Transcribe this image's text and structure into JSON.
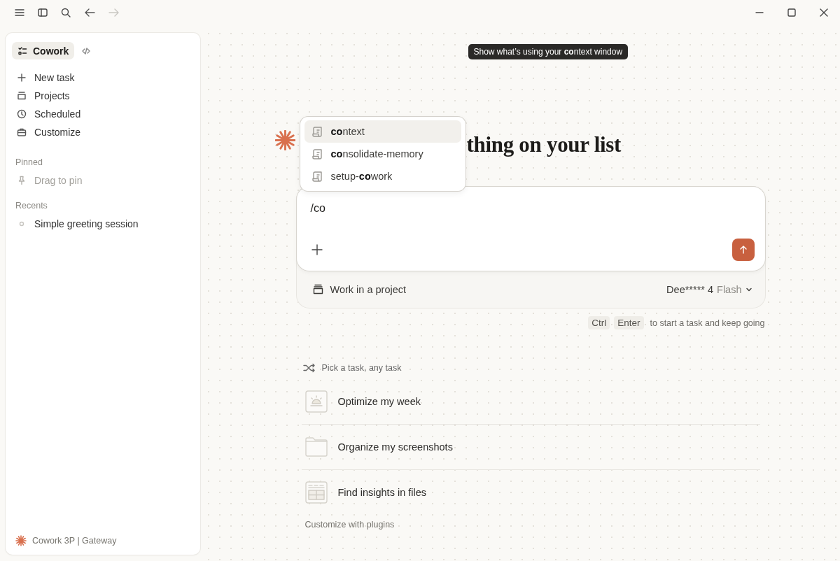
{
  "titlebar": {
    "back": {
      "disabled": false
    },
    "forward": {
      "disabled": true
    }
  },
  "sidebar": {
    "mode_tabs": [
      {
        "label": "Cowork",
        "selected": true
      }
    ],
    "nav": [
      {
        "label": "New task"
      },
      {
        "label": "Projects"
      },
      {
        "label": "Scheduled"
      },
      {
        "label": "Customize"
      }
    ],
    "pinned": {
      "heading": "Pinned",
      "hint": "Drag to pin"
    },
    "recents": {
      "heading": "Recents",
      "items": [
        {
          "label": "Simple greeting session"
        }
      ]
    },
    "footer": "Cowork 3P | Gateway"
  },
  "heading": "thing on your list",
  "command_menu": {
    "items": [
      {
        "label": "**co**ntext",
        "selected": true
      },
      {
        "label": "**co**nsolidate-memory",
        "selected": false
      },
      {
        "label": "setup-**co**work",
        "selected": false
      }
    ]
  },
  "tooltip": "Show what’s using your **co**ntext window",
  "composer": {
    "value": "/co",
    "project_button": "Work in a project",
    "model_name": "Dee***** 4",
    "model_variant": "Flash"
  },
  "shortcut": {
    "keys": [
      "Ctrl",
      "Enter"
    ],
    "text": "to start a task and keep going"
  },
  "suggestions": {
    "heading": "Pick a task, any task",
    "items": [
      {
        "label": "Optimize my week"
      },
      {
        "label": "Organize my screenshots"
      },
      {
        "label": "Find insights in files"
      }
    ],
    "footer_link": "Customize with plugins"
  }
}
